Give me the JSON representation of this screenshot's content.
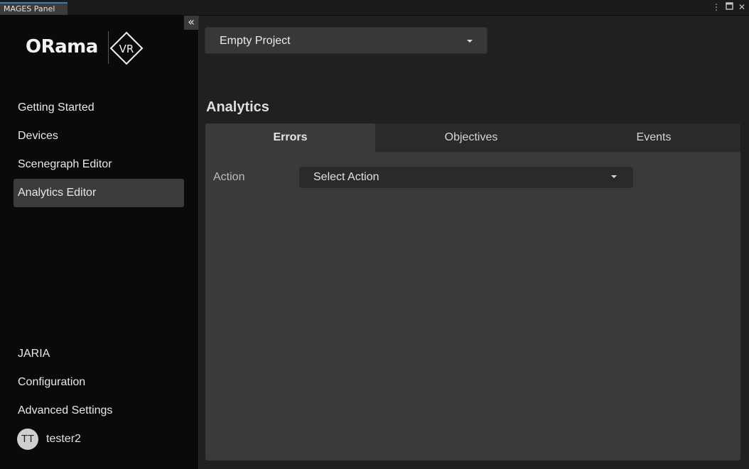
{
  "window": {
    "tab_title": "MAGES Panel",
    "controls": [
      "more-icon",
      "maximize-icon",
      "close-icon"
    ]
  },
  "sidebar": {
    "collapse_icon": "double-chevron-left-icon",
    "logo": {
      "text": "ORama",
      "badge": "VR"
    },
    "nav_top": [
      {
        "label": "Getting Started",
        "active": false
      },
      {
        "label": "Devices",
        "active": false
      },
      {
        "label": "Scenegraph Editor",
        "active": false
      },
      {
        "label": "Analytics Editor",
        "active": true
      }
    ],
    "nav_bottom": [
      {
        "label": "JARIA"
      },
      {
        "label": "Configuration"
      },
      {
        "label": "Advanced Settings"
      }
    ],
    "user": {
      "initials": "TT",
      "name": "tester2"
    }
  },
  "main": {
    "project_dropdown": {
      "selected": "Empty Project"
    },
    "section_title": "Analytics",
    "tabs": [
      {
        "label": "Errors",
        "active": true
      },
      {
        "label": "Objectives",
        "active": false
      },
      {
        "label": "Events",
        "active": false
      }
    ],
    "action_field": {
      "label": "Action",
      "selected": "Select Action"
    }
  },
  "colors": {
    "accent": "#3a79bb",
    "sidebar_bg": "#0a0a0a",
    "main_bg": "#202020",
    "panel_bg": "#3a3a3a",
    "active_nav_bg": "#3b3b3b"
  }
}
